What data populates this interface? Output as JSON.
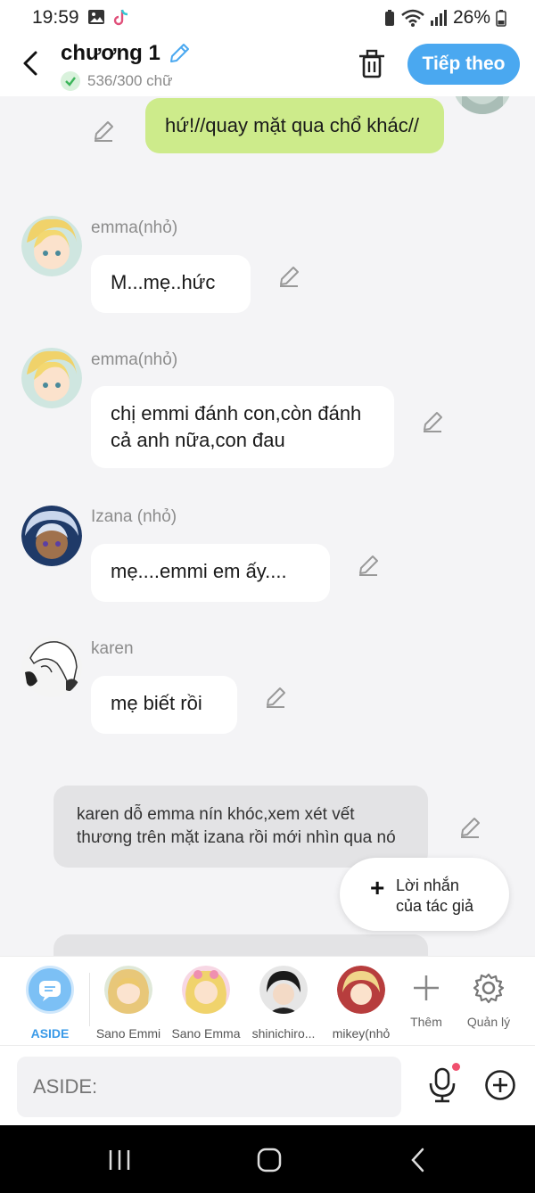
{
  "status_bar": {
    "time": "19:59",
    "battery": "26%"
  },
  "header": {
    "title": "chương 1",
    "word_count": "536/300 chữ",
    "next_label": "Tiếp theo"
  },
  "messages": [
    {
      "type": "self",
      "text": "hứ!//quay mặt qua chổ khác//"
    },
    {
      "type": "character",
      "name": "emma(nhỏ)",
      "text": "M...mẹ..hức"
    },
    {
      "type": "character",
      "name": "emma(nhỏ)",
      "text": "chị emmi đánh con,còn đánh cả anh nữa,con đau"
    },
    {
      "type": "character",
      "name": "Izana (nhỏ)",
      "text": "mẹ....emmi em ấy...."
    },
    {
      "type": "character",
      "name": "karen",
      "text": "mẹ biết rồi"
    },
    {
      "type": "aside",
      "text": "karen dỗ emma nín khóc,xem xét vết thương trên mặt izana rồi mới nhìn qua nó"
    }
  ],
  "author_note": {
    "line1": "Lời nhắn",
    "line2": "của tác giả"
  },
  "characters": [
    {
      "label": "ASIDE"
    },
    {
      "label": "Sano Emmi"
    },
    {
      "label": "Sano Emma"
    },
    {
      "label": "shinichiro..."
    },
    {
      "label": "mikey(nhỏ"
    }
  ],
  "tools": {
    "add_label": "Thêm",
    "manage_label": "Quản lý"
  },
  "input": {
    "placeholder": "ASIDE:"
  },
  "colors": {
    "accent": "#4aa8f0",
    "self_bubble": "#cdeb8b",
    "aside_bubble": "#e3e3e5",
    "background": "#f4f4f6"
  }
}
